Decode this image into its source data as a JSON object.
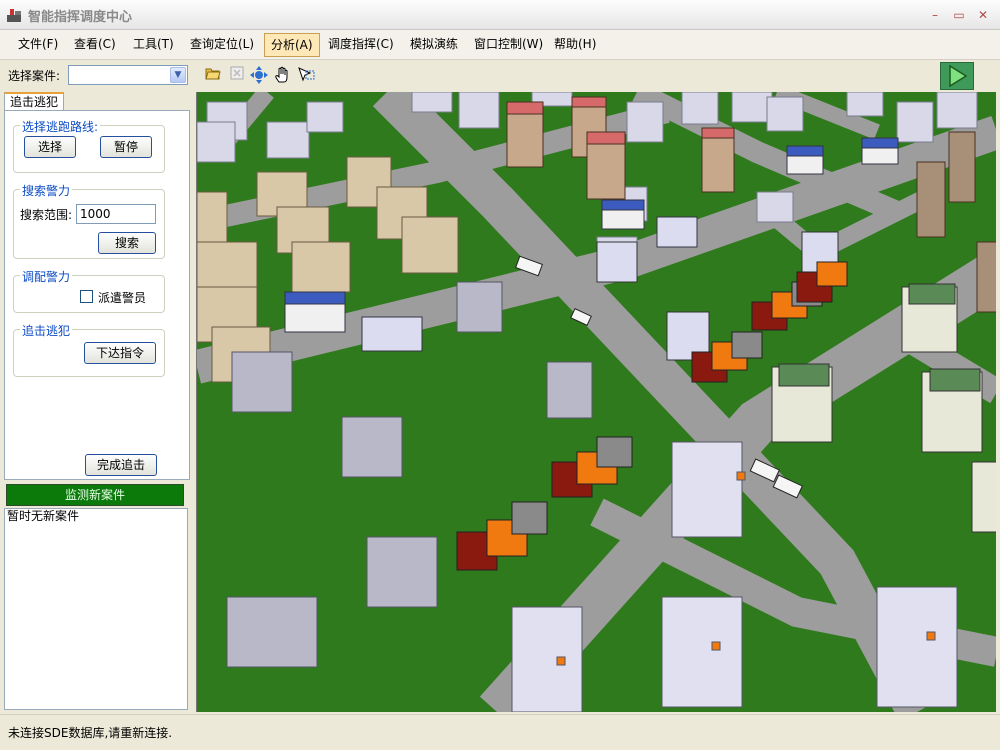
{
  "window": {
    "title": "智能指挥调度中心",
    "controls": [
      "–",
      "▭",
      "✕"
    ]
  },
  "menu": [
    {
      "label": "文件(F)"
    },
    {
      "label": "查看(C)"
    },
    {
      "label": "工具(T)"
    },
    {
      "label": "查询定位(L)"
    },
    {
      "label": "分析(A)",
      "active": true
    },
    {
      "label": "调度指挥(C)"
    },
    {
      "label": "模拟演练"
    },
    {
      "label": "窗口控制(W)"
    },
    {
      "label": "帮助(H)"
    }
  ],
  "toolbar": {
    "case_label": "选择案件:",
    "case_value": "",
    "icons": [
      "folder-open-icon",
      "close-map-icon",
      "pan-cross-icon",
      "hand-icon",
      "select-arrow-icon"
    ]
  },
  "left_panel": {
    "tab_label": "追击逃犯",
    "route_group": {
      "title": "选择逃跑路线:",
      "select_label": "选择",
      "pause_label": "暂停"
    },
    "search_group": {
      "title": "搜索警力",
      "range_label": "搜索范围:",
      "range_value": "1000",
      "search_label": "搜索"
    },
    "dispatch_group": {
      "title": "调配警力",
      "checkbox_label": "派遣警员",
      "checked": false
    },
    "pursue_group": {
      "title": "追击逃犯",
      "order_label": "下达指令"
    },
    "finish_label": "完成追击"
  },
  "monitor": {
    "label": "监测新案件",
    "list_text": "暂时无新案件"
  },
  "status": {
    "text": "未连接SDE数据库,请重新连接."
  },
  "colors": {
    "grass": "#2f7a1d",
    "road": "#9d9d9d",
    "monitor": "#0b7a0b"
  }
}
